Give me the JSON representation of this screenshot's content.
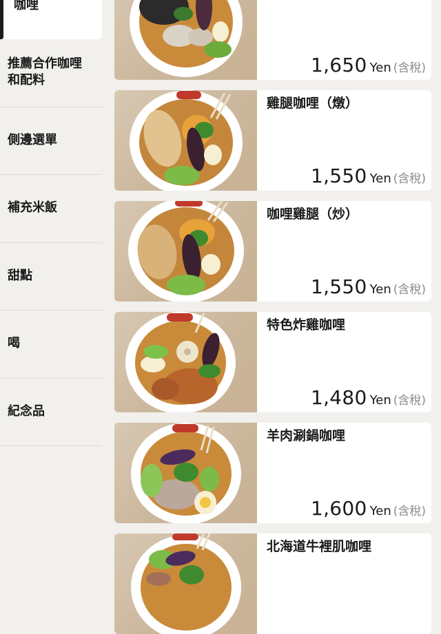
{
  "sidebar": {
    "active": {
      "label": "咖哩"
    },
    "items": [
      {
        "label": "推薦合作咖哩\n和配料"
      },
      {
        "label": "側邊選單"
      },
      {
        "label": "補充米飯"
      },
      {
        "label": "甜點"
      },
      {
        "label": "喝"
      },
      {
        "label": "紀念品"
      }
    ]
  },
  "menu": {
    "items": [
      {
        "name": "",
        "price": "1,650",
        "currency": "Yen",
        "tax_note": "(含稅)"
      },
      {
        "name": "雞腿咖哩（燉）",
        "price": "1,550",
        "currency": "Yen",
        "tax_note": "(含稅)"
      },
      {
        "name": "咖哩雞腿（炒）",
        "price": "1,550",
        "currency": "Yen",
        "tax_note": "(含稅)"
      },
      {
        "name": "特色炸雞咖哩",
        "price": "1,480",
        "currency": "Yen",
        "tax_note": "(含稅)"
      },
      {
        "name": "羊肉涮鍋咖哩",
        "price": "1,600",
        "currency": "Yen",
        "tax_note": "(含稅)"
      },
      {
        "name": "北海道牛裡肌咖哩",
        "price": "",
        "currency": "",
        "tax_note": ""
      }
    ]
  }
}
